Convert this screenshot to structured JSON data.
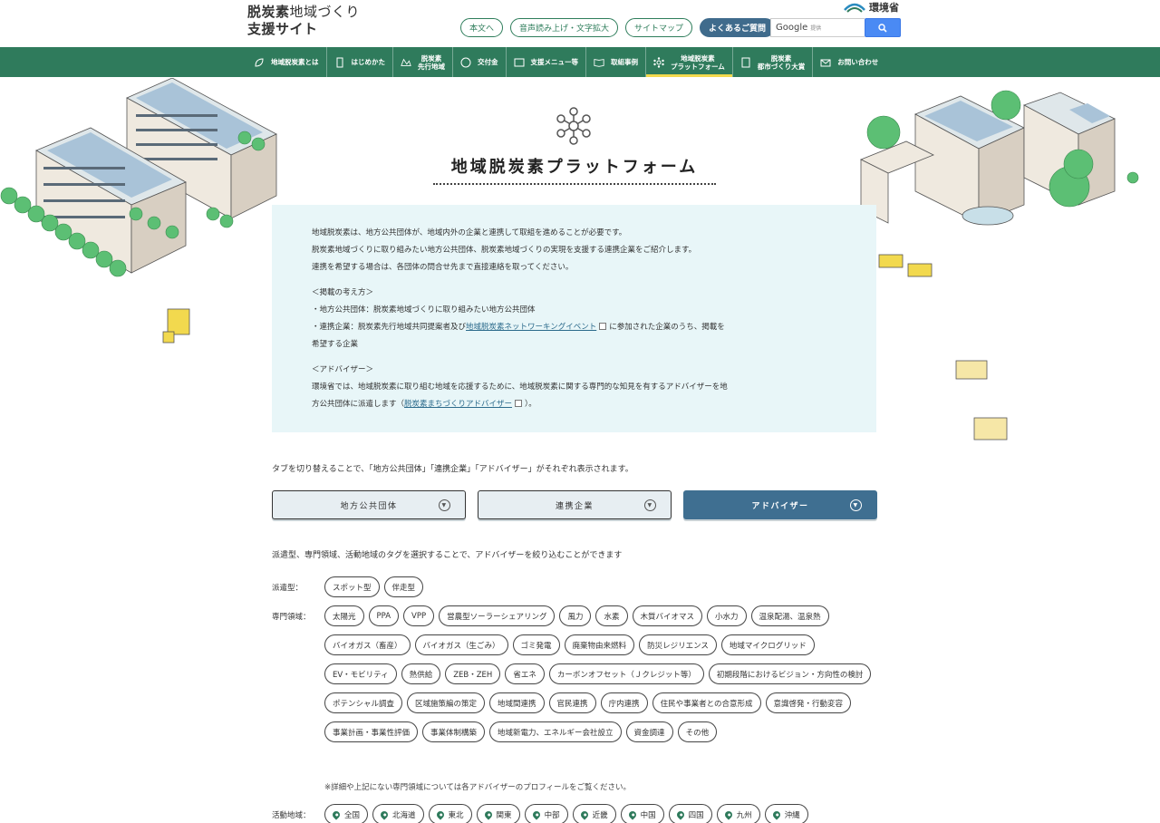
{
  "header": {
    "logo_line1_bold": "脱炭素",
    "logo_line1_thin": "地域づくり",
    "logo_line2": "支援サイト",
    "ministry": "環境省",
    "buttons": [
      "本文へ",
      "音声読み上げ・文字拡大",
      "サイトマップ",
      "よくあるご質問"
    ],
    "search_brand": "Google",
    "search_hint": "提供"
  },
  "nav": {
    "items": [
      {
        "label": "地域脱炭素とは",
        "icon": "leaf-icon"
      },
      {
        "label": "はじめかた",
        "icon": "book-icon"
      },
      {
        "label": "脱炭素\n先行地域",
        "icon": "map-icon"
      },
      {
        "label": "交付金",
        "icon": "coin-icon"
      },
      {
        "label": "支援メニュー等",
        "icon": "menu-icon"
      },
      {
        "label": "取組事例",
        "icon": "open-book-icon"
      },
      {
        "label": "地域脱炭素\nプラットフォーム",
        "icon": "network-icon"
      },
      {
        "label": "脱炭素\n都市づくり大賞",
        "icon": "building-icon"
      },
      {
        "label": "お問い合わせ",
        "icon": "mail-icon"
      }
    ],
    "active_index": 6
  },
  "page": {
    "title": "地域脱炭素プラットフォーム"
  },
  "info": {
    "p1": "地域脱炭素は、地方公共団体が、地域内外の企業と連携して取組を進めることが必要です。",
    "p2": "脱炭素地域づくりに取り組みたい地方公共団体、脱炭素地域づくりの実現を支援する連携企業をご紹介します。",
    "p3": "連携を希望する場合は、各団体の問合せ先まで直接連絡を取ってください。",
    "policy_heading": "＜掲載の考え方＞",
    "policy_1": "・地方公共団体：脱炭素地域づくりに取り組みたい地方公共団体",
    "policy_2_pre": "・連携企業：脱炭素先行地域共同提案者及び",
    "policy_2_link": "地域脱炭素ネットワーキングイベント",
    "policy_2_post": "に参加された企業のうち、掲載を",
    "policy_2_wrap": "希望する企業",
    "advisor_heading": "＜アドバイザー＞",
    "advisor_1": "環境省では、地域脱炭素に取り組む地域を応援するために、地域脱炭素に関する専門的な知見を有するアドバイザーを地",
    "advisor_2_pre": "方公共団体に派遣します（",
    "advisor_2_link": "脱炭素まちづくりアドバイザー",
    "advisor_2_post": "）。"
  },
  "tabs": {
    "note": "タブを切り替えることで、「地方公共団体」「連携企業」「アドバイザー」がそれぞれ表示されます。",
    "items": [
      "地方公共団体",
      "連携企業",
      "アドバイザー"
    ],
    "active_index": 2
  },
  "filters": {
    "note": "派遣型、専門領域、活動地域のタグを選択することで、アドバイザーを絞り込むことができます",
    "dispatch_label": "派遣型：",
    "dispatch": [
      "スポット型",
      "伴走型"
    ],
    "field_label": "専門領域：",
    "fields": [
      "太陽光",
      "PPA",
      "VPP",
      "営農型ソーラーシェアリング",
      "風力",
      "水素",
      "木質バイオマス",
      "小水力",
      "温泉配湯、温泉熱",
      "バイオガス（畜産）",
      "バイオガス（生ごみ）",
      "ゴミ発電",
      "廃棄物由来燃料",
      "防災レジリエンス",
      "地域マイクログリッド",
      "EV・モビリティ",
      "熱供給",
      "ZEB・ZEH",
      "省エネ",
      "カーボンオフセット（Ｊクレジット等）",
      "初期段階におけるビジョン・方向性の検討",
      "ポテンシャル調査",
      "区域施策編の策定",
      "地域間連携",
      "官民連携",
      "庁内連携",
      "住民や事業者との合意形成",
      "意識啓発・行動変容",
      "事業計画・事業性評価",
      "事業体制構築",
      "地域新電力、エネルギー会社設立",
      "資金調達",
      "その他"
    ],
    "field_note": "※詳細や上記にない専門領域については各アドバイザーのプロフィールをご覧ください。",
    "region_label": "活動地域：",
    "regions": [
      "全国",
      "北海道",
      "東北",
      "関東",
      "中部",
      "近畿",
      "中国",
      "四国",
      "九州",
      "沖縄"
    ]
  },
  "colors": {
    "nav_green": "#2f7b5c",
    "active_tab": "#3f6f91",
    "info_bg": "#e8f6f8",
    "search_blue": "#4a8af4"
  }
}
